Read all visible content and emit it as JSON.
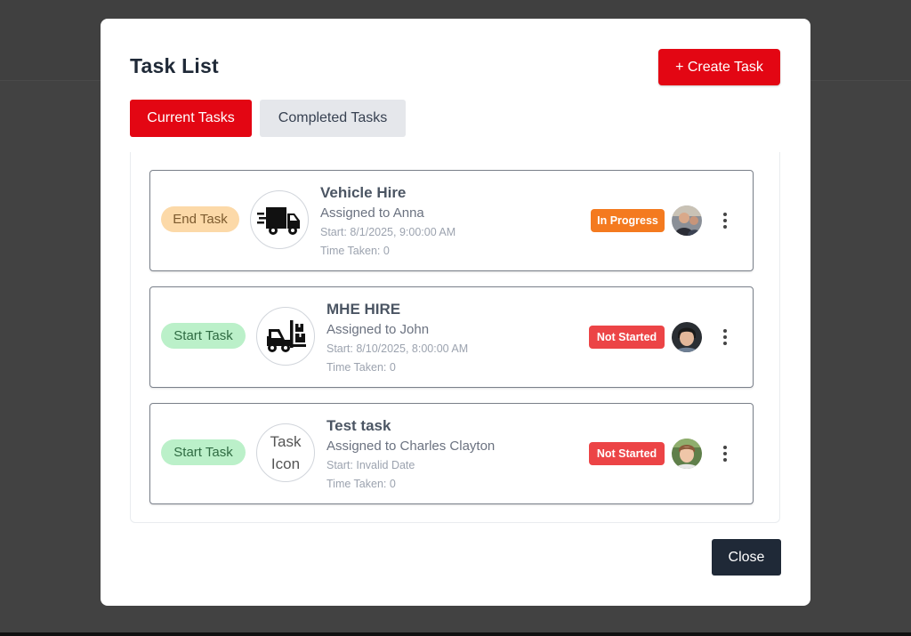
{
  "modal": {
    "title": "Task List",
    "create_label": "+ Create Task",
    "close_label": "Close"
  },
  "tabs": [
    {
      "label": "Current Tasks",
      "active": true
    },
    {
      "label": "Completed Tasks",
      "active": false
    }
  ],
  "tasks": [
    {
      "action_label": "End Task",
      "icon": "truck-icon",
      "title": "Vehicle Hire",
      "assigned": "Assigned to Anna",
      "start": "Start: 8/1/2025, 9:00:00 AM",
      "time_taken": "Time Taken: 0",
      "status": "In Progress",
      "status_color": "#f47a1f"
    },
    {
      "action_label": "Start Task",
      "icon": "forklift-icon",
      "title": "MHE HIRE",
      "assigned": "Assigned to John",
      "start": "Start: 8/10/2025, 8:00:00 AM",
      "time_taken": "Time Taken: 0",
      "status": "Not Started",
      "status_color": "#ec4446"
    },
    {
      "action_label": "Start Task",
      "icon": "placeholder-icon",
      "icon_text": "Task\nIcon",
      "title": "Test task",
      "assigned": "Assigned to Charles Clayton",
      "start": "Start: Invalid Date",
      "time_taken": "Time Taken: 0",
      "status": "Not Started",
      "status_color": "#ec4446"
    }
  ],
  "colors": {
    "accent": "#e30613",
    "dark_button": "#1f2937",
    "backdrop": "#424242"
  }
}
